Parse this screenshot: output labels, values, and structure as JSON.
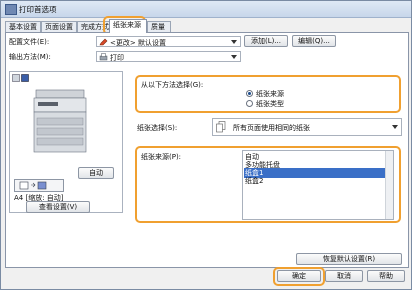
{
  "window": {
    "title": "打印首选项"
  },
  "tabs": [
    "基本设置",
    "页面设置",
    "完成方式",
    "纸张来源",
    "质量"
  ],
  "profile": {
    "label": "配置文件(E):",
    "value": "<更改> 默认设置",
    "add_label": "添加(L)...",
    "edit_label": "编辑(Q)..."
  },
  "output": {
    "label": "输出方法(M):",
    "value": "打印"
  },
  "preview": {
    "auto_label": "自动",
    "status_text": "A4 [缩放: 自动]",
    "view_settings_label": "查看设置(V)"
  },
  "select_from": {
    "label": "从以下方法选择(G):",
    "options": [
      "纸张来源",
      "纸张类型"
    ],
    "selected_index": 0
  },
  "paper_selection": {
    "label": "纸张选择(S):",
    "value": "所有页面使用相同的纸张"
  },
  "paper_source": {
    "label": "纸张来源(P):",
    "items": [
      "自动",
      "多功能托盘",
      "纸盒1",
      "纸盒2"
    ],
    "selected_index": 2
  },
  "restore_defaults_label": "恢复默认设置(R)",
  "footer": {
    "ok_label": "确定",
    "cancel_label": "取消",
    "help_label": "帮助"
  },
  "colors": {
    "highlight": "#f0a030",
    "selection": "#3a6fc7"
  }
}
